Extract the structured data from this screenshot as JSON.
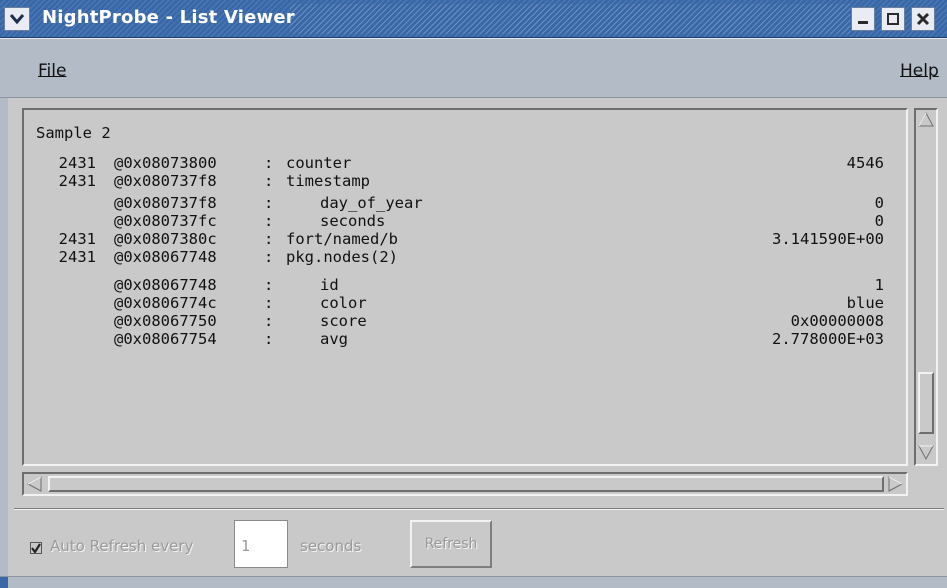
{
  "window": {
    "title": "NightProbe - List Viewer",
    "buttons": [
      "minimize-icon",
      "maximize-icon",
      "close-icon"
    ]
  },
  "menu": {
    "file": "File",
    "help": "Help"
  },
  "list": {
    "sample_title": "Sample 2",
    "rows": [
      {
        "id": "2431",
        "addr": "@0x08073800",
        "sep": ":",
        "name": "counter",
        "value": "4546",
        "child": false
      },
      {
        "id": "2431",
        "addr": "@0x080737f8",
        "sep": ":",
        "name": "timestamp",
        "value": "",
        "child": false
      },
      {
        "id": "",
        "addr": "@0x080737f8",
        "sep": ":",
        "name": "day_of_year",
        "value": "0",
        "child": true
      },
      {
        "id": "",
        "addr": "@0x080737fc",
        "sep": ":",
        "name": "seconds",
        "value": "0",
        "child": true
      },
      {
        "id": "2431",
        "addr": "@0x0807380c",
        "sep": ":",
        "name": "fort/named/b",
        "value": "3.141590E+00",
        "child": false
      },
      {
        "id": "2431",
        "addr": "@0x08067748",
        "sep": ":",
        "name": "pkg.nodes(2)",
        "value": "",
        "child": false
      },
      {
        "id": "",
        "addr": "@0x08067748",
        "sep": ":",
        "name": "id",
        "value": "1",
        "child": true
      },
      {
        "id": "",
        "addr": "@0x0806774c",
        "sep": ":",
        "name": "color",
        "value": "blue",
        "child": true
      },
      {
        "id": "",
        "addr": "@0x08067750",
        "sep": ":",
        "name": "score",
        "value": "0x00000008",
        "child": true
      },
      {
        "id": "",
        "addr": "@0x08067754",
        "sep": ":",
        "name": "avg",
        "value": "2.778000E+03",
        "child": true
      }
    ]
  },
  "controls": {
    "auto_refresh_label": "Auto Refresh every",
    "auto_refresh_checked": true,
    "seconds_value": "1",
    "seconds_label": "seconds",
    "refresh_button": "Refresh"
  },
  "colors": {
    "titlebar": "#3a68a6",
    "menubar": "#b3bcc6",
    "panel": "#c9c9c9"
  }
}
